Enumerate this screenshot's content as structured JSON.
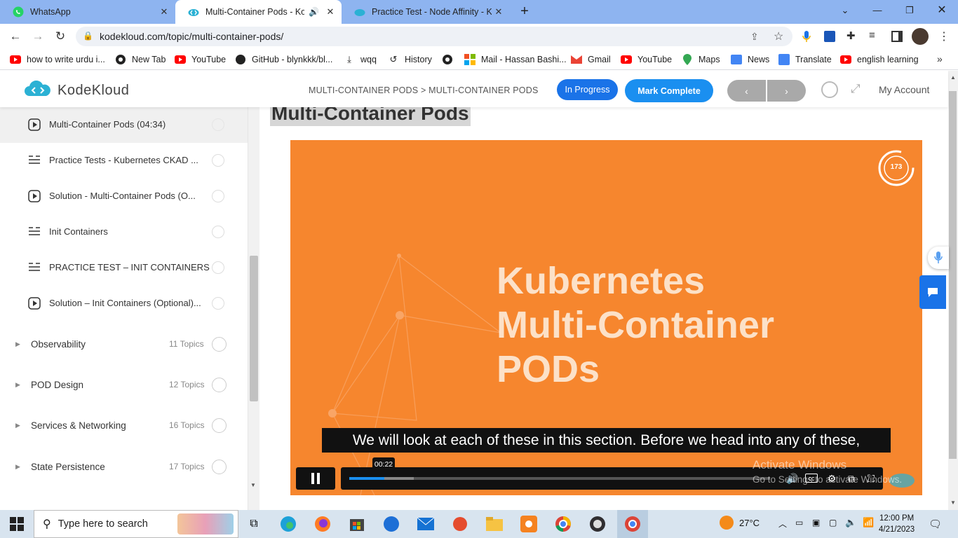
{
  "browser": {
    "tabs": [
      {
        "title": "WhatsApp",
        "icon": "whatsapp-icon",
        "active": false
      },
      {
        "title": "Multi-Container Pods - Kode",
        "icon": "kodekloud-icon",
        "active": true
      },
      {
        "title": "Practice Test - Node Affinity - Ko",
        "icon": "kodekloud-icon",
        "active": false
      }
    ],
    "url": "kodekloud.com/topic/multi-container-pods/",
    "bookmarks": [
      {
        "label": "how to write urdu i...",
        "icon": "youtube-icon"
      },
      {
        "label": "New Tab",
        "icon": "globe-icon"
      },
      {
        "label": "YouTube",
        "icon": "youtube-icon"
      },
      {
        "label": "GitHub - blynkkk/bl...",
        "icon": "github-icon"
      },
      {
        "label": "wqq",
        "icon": "download-icon"
      },
      {
        "label": "History",
        "icon": "history-icon"
      },
      {
        "label": "",
        "icon": "globe-icon"
      },
      {
        "label": "Mail - Hassan Bashi...",
        "icon": "microsoft-icon"
      },
      {
        "label": "Gmail",
        "icon": "gmail-icon"
      },
      {
        "label": "YouTube",
        "icon": "youtube-icon"
      },
      {
        "label": "Maps",
        "icon": "maps-icon"
      },
      {
        "label": "News",
        "icon": "news-icon"
      },
      {
        "label": "Translate",
        "icon": "translate-icon"
      },
      {
        "label": "english learning",
        "icon": "youtube-icon"
      }
    ]
  },
  "header": {
    "logo": "KodeKloud",
    "breadcrumb": "MULTI-CONTAINER PODS > MULTI-CONTAINER PODS",
    "status": "In Progress",
    "mark_complete": "Mark Complete",
    "prev": "‹",
    "next": "›",
    "account": "My Account"
  },
  "sidebar": {
    "lessons": [
      {
        "label": "Multi-Container Pods (04:34)",
        "type": "video",
        "current": true
      },
      {
        "label": "Practice Tests - Kubernetes CKAD ...",
        "type": "lab"
      },
      {
        "label": "Solution - Multi-Container Pods (O...",
        "type": "video"
      },
      {
        "label": "Init Containers",
        "type": "lab"
      },
      {
        "label": "PRACTICE TEST – INIT CONTAINERS",
        "type": "lab"
      },
      {
        "label": "Solution – Init Containers (Optional)...",
        "type": "video"
      }
    ],
    "sections": [
      {
        "title": "Observability",
        "count": "11 Topics"
      },
      {
        "title": "POD Design",
        "count": "12 Topics"
      },
      {
        "title": "Services & Networking",
        "count": "16 Topics"
      },
      {
        "title": "State Persistence",
        "count": "17 Topics"
      }
    ]
  },
  "main": {
    "title": "Multi-Container Pods",
    "video": {
      "slide_line1": "Kubernetes",
      "slide_line2": "Multi-Container",
      "slide_line3": "PODs",
      "badge": "173",
      "caption": "We will look at each of these in this section. Before we head into any of these,",
      "time": "00:22",
      "progress": 0.083,
      "buffered": 0.153,
      "accent": "#1a8ff0"
    },
    "watermark_line1": "Activate Windows",
    "watermark_line2": "Go to Settings to activate Windows."
  },
  "taskbar": {
    "search_placeholder": "Type here to search",
    "weather": "27°C",
    "time": "12:00 PM",
    "date": "4/21/2023"
  }
}
